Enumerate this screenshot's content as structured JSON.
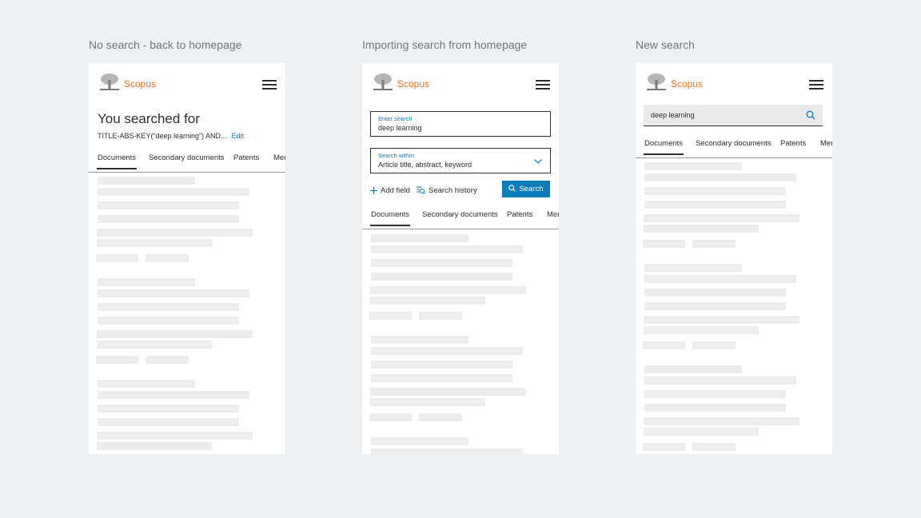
{
  "colors": {
    "background": "#edf1f4",
    "brand": "#e9711c",
    "accent": "#0c7dbb",
    "skeleton": "#ececec"
  },
  "brand_name": "Scopus",
  "icons": [
    "elsevier-tree-logo",
    "hamburger-menu-icon",
    "plus-icon",
    "search-history-icon",
    "search-icon",
    "chevron-down-icon"
  ],
  "tabs": [
    "Documents",
    "Secondary documents",
    "Patents",
    "Mer"
  ],
  "panels": {
    "no_search": {
      "caption": "No search - back to homepage",
      "heading": "You searched for",
      "query": "TITLE-ABS-KEY(“deep learning”) AND...",
      "edit": "Edit"
    },
    "importing": {
      "caption": "Importing search from homepage",
      "search_label": "Enter search",
      "search_value": "deep learning",
      "within_label": "Search within",
      "within_value": "Article title, abstract, keyword",
      "add_field": "Add field",
      "search_history": "Search history",
      "search_button": "Search"
    },
    "new_search": {
      "caption": "New search",
      "search_value": "deep learning"
    }
  }
}
